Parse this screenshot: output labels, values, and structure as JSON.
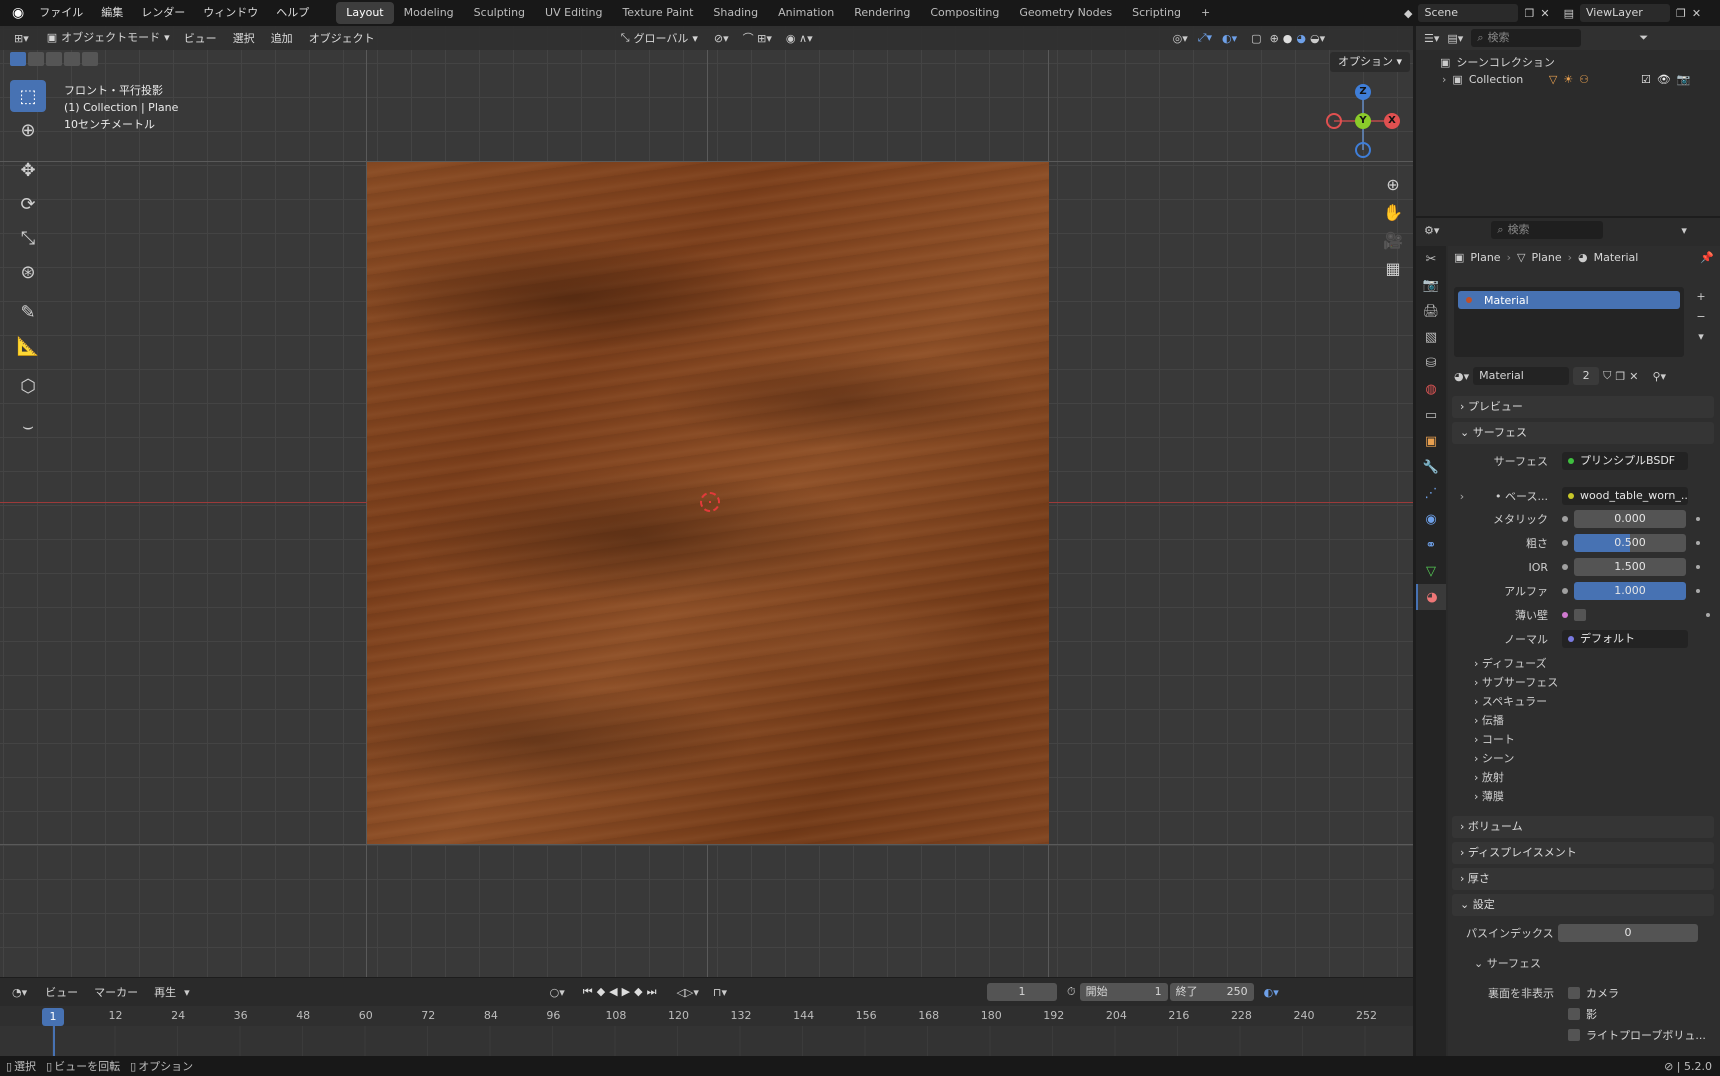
{
  "topbar": {
    "menus": [
      "ファイル",
      "編集",
      "レンダー",
      "ウィンドウ",
      "ヘルプ"
    ],
    "workspaces": [
      "Layout",
      "Modeling",
      "Sculpting",
      "UV Editing",
      "Texture Paint",
      "Shading",
      "Animation",
      "Rendering",
      "Compositing",
      "Geometry Nodes",
      "Scripting"
    ],
    "add_ws": "+",
    "scene": "Scene",
    "view_layer": "ViewLayer"
  },
  "viewport": {
    "mode": "オブジェクトモード",
    "menus": [
      "ビュー",
      "選択",
      "追加",
      "オブジェクト"
    ],
    "transform": "グローバル",
    "options": "オプション",
    "overlay_lines": [
      "フロント・平行投影",
      "(1) Collection | Plane",
      "10センチメートル"
    ],
    "gizmo": {
      "z": "Z",
      "y": "Y",
      "x": "X"
    }
  },
  "timeline": {
    "menus": [
      "ビュー",
      "マーカー",
      "再生"
    ],
    "current_frame": "1",
    "start_label": "開始",
    "start": "1",
    "end_label": "終了",
    "end": "250",
    "ticks": [
      "12",
      "24",
      "36",
      "48",
      "60",
      "72",
      "84",
      "96",
      "108",
      "120",
      "132",
      "144",
      "156",
      "168",
      "180",
      "192",
      "204",
      "216",
      "228",
      "240",
      "252"
    ],
    "playhead": "1"
  },
  "statusbar": {
    "items": [
      "選択",
      "ビューを回転",
      "オプション"
    ],
    "version": "5.2.0"
  },
  "outliner": {
    "search_placeholder": "検索",
    "scene_collection": "シーンコレクション",
    "collection": "Collection"
  },
  "properties": {
    "search_placeholder": "検索",
    "breadcrumb": [
      "Plane",
      "Plane",
      "Material"
    ],
    "slot": "Material",
    "material_name": "Material",
    "users": "2",
    "panels": {
      "preview": "プレビュー",
      "surface": "サーフェス",
      "volume": "ボリューム",
      "displacement": "ディスプレイスメント",
      "thickness": "厚さ",
      "settings": "設定"
    },
    "surface_rows": [
      {
        "label": "サーフェス",
        "value": "プリンシプルBSDF",
        "color": "#3fbf3f"
      },
      {
        "label": "ベース...",
        "value": "wood_table_worn_...",
        "color": "#c7c729"
      }
    ],
    "numeric_rows": [
      {
        "label": "メタリック",
        "value": "0.000"
      },
      {
        "label": "粗さ",
        "value": "0.500"
      },
      {
        "label": "IOR",
        "value": "1.500"
      },
      {
        "label": "アルファ",
        "value": "1.000"
      }
    ],
    "thin_wall": "薄い壁",
    "normal_label": "ノーマル",
    "normal_value": "デフォルト",
    "subpanels": [
      "ディフューズ",
      "サブサーフェス",
      "スペキュラー",
      "伝播",
      "コート",
      "シーン",
      "放射",
      "薄膜"
    ],
    "pass_index_label": "パスインデックス",
    "pass_index": "0",
    "settings_surface": "サーフェス",
    "backface_label": "裏面を非表示",
    "backface_opts": [
      "カメラ",
      "影",
      "ライトプローブボリュ..."
    ]
  }
}
